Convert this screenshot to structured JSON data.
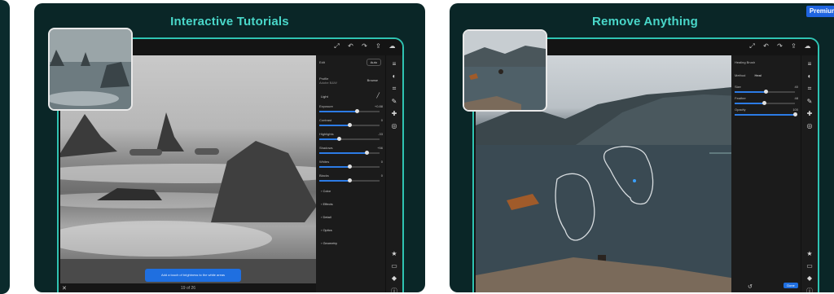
{
  "cards": [
    {
      "title": "Interactive Tutorials",
      "panel": {
        "edit_label": "Edit",
        "auto_label": "Auto",
        "profile_label": "Profile",
        "profile_value": "Adobe B&W",
        "browse_label": "Browse",
        "light_label": "Light",
        "sliders": [
          {
            "label": "Exposure",
            "value": "+0.88",
            "level": 0.62
          },
          {
            "label": "Contrast",
            "value": "0",
            "level": 0.5
          },
          {
            "label": "Highlights",
            "value": "-33",
            "level": 0.32
          },
          {
            "label": "Shadows",
            "value": "+56",
            "level": 0.78
          },
          {
            "label": "Whites",
            "value": "0",
            "level": 0.5
          },
          {
            "label": "Blacks",
            "value": "0",
            "level": 0.5
          }
        ],
        "sections": [
          "Color",
          "Effects",
          "Detail",
          "Optics",
          "Geometry"
        ]
      },
      "hint": "Add a touch of brightness to the white areas",
      "page_indicator": "19 of 26"
    },
    {
      "title": "Remove Anything",
      "badge": "Premium",
      "panel": {
        "mode_label": "Healing Brush",
        "method_label": "Method",
        "method_value": "Heal",
        "sliders": [
          {
            "label": "Size",
            "value": "40",
            "level": 0.52
          },
          {
            "label": "Feather",
            "value": "48",
            "level": 0.48
          },
          {
            "label": "Opacity",
            "value": "100",
            "level": 1.0
          }
        ]
      },
      "done_label": "Done"
    }
  ]
}
